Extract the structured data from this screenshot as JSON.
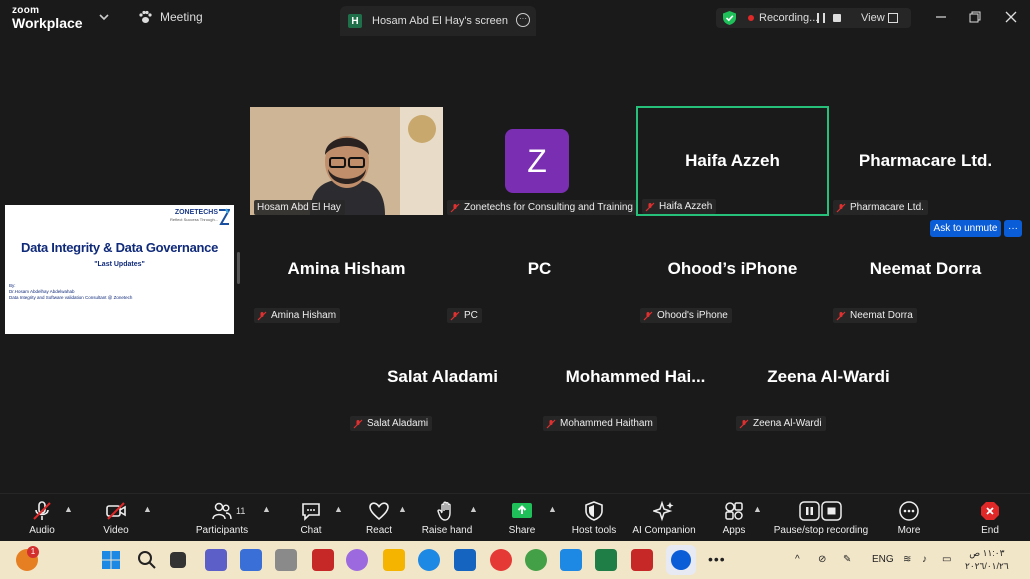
{
  "app": {
    "logo_line1": "zoom",
    "logo_line2": "Workplace"
  },
  "titlebar": {
    "meeting_label": "Meeting",
    "share_tab_initial": "H",
    "share_tab_title": "Hosam Abd El Hay's screen",
    "recording_label": "Recording...",
    "view_label": "View"
  },
  "slide": {
    "brand": "ZONETECHS",
    "brand_sub": "Reflect Success Through...",
    "title": "Data Integrity & Data Governance",
    "subtitle": "\"Last Updates\"",
    "by": "By:",
    "author": "Dr.Hosam Abdelhay Abdelwahab",
    "role": "Data Integrity and Software validation Consultant @ Zonetech"
  },
  "participants": [
    {
      "display": "",
      "label": "Hosam Abd El Hay"
    },
    {
      "display": "Z",
      "label": "Zonetechs for Consulting and Training"
    },
    {
      "display": "Haifa Azzeh",
      "label": "Haifa Azzeh"
    },
    {
      "display": "Pharmacare Ltd.",
      "label": "Pharmacare Ltd."
    },
    {
      "display": "Amina Hisham",
      "label": "Amina Hisham"
    },
    {
      "display": "PC",
      "label": "PC"
    },
    {
      "display": "Ohood’s iPhone",
      "label": "Ohood's iPhone"
    },
    {
      "display": "Neemat Dorra",
      "label": "Neemat Dorra"
    },
    {
      "display": "Salat Aladami",
      "label": "Salat Aladami"
    },
    {
      "display": "Mohammed  Hai...",
      "label": "Mohammed Haitham"
    },
    {
      "display": "Zeena Al-Wardi",
      "label": "Zeena Al-Wardi"
    }
  ],
  "ask_to_unmute": "Ask to unmute",
  "more_small": "···",
  "toolbar": {
    "audio": "Audio",
    "video": "Video",
    "participants": "Participants",
    "participants_count": "11",
    "chat": "Chat",
    "react": "React",
    "raise_hand": "Raise hand",
    "share": "Share",
    "host_tools": "Host tools",
    "ai_companion": "AI Companion",
    "apps": "Apps",
    "pause_stop": "Pause/stop recording",
    "more": "More",
    "end": "End"
  },
  "taskbar": {
    "notif_count": "1",
    "lang": "ENG",
    "time": "١١:٠٣ ص",
    "date": "٢٠٢٦/٠١/٢٦"
  },
  "colors": {
    "accent_green": "#27c07a",
    "blue": "#0b5cd7",
    "end_red": "#e02828"
  }
}
